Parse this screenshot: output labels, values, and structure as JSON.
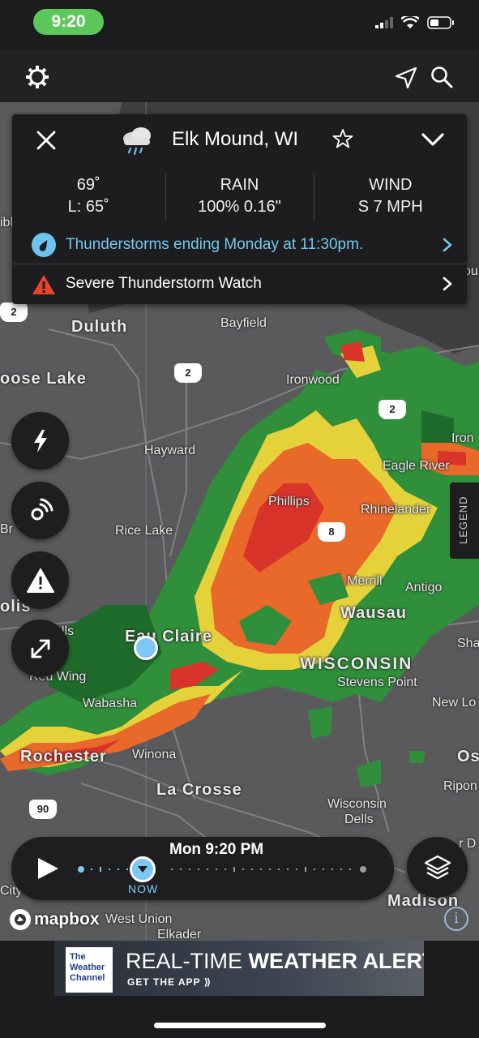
{
  "status_bar": {
    "time": "9:20"
  },
  "location_card": {
    "location": "Elk Mound, WI",
    "temp": {
      "high": "69˚",
      "low": "L: 65˚"
    },
    "rain": {
      "label": "RAIN",
      "value": "100% 0.16\""
    },
    "wind": {
      "label": "WIND",
      "value": "S 7 MPH"
    },
    "forecast_text": "Thunderstorms ending Monday at 11:30pm.",
    "alert_text": "Severe Thunderstorm Watch"
  },
  "map_labels": {
    "duluth": "Duluth",
    "bayfield": "Bayfield",
    "moose_lake": "oose Lake",
    "ironwood": "Ironwood",
    "iron": "Iron",
    "eagle_river": "Eagle River",
    "hayward": "Hayward",
    "phillips": "Phillips",
    "rhinelander": "Rhinelander",
    "rice_lake": "Rice Lake",
    "merrill": "Merrill",
    "antigo": "Antigo",
    "wausau": "Wausau",
    "eau_claire": "Eau Claire",
    "wisconsin": "WISCONSIN",
    "stevens_point": "Stevens Point",
    "sha": "Sha",
    "red_wing": "Red Wing",
    "wabasha": "Wabasha",
    "new_lo": "New Lo",
    "rochester": "Rochester",
    "winona": "Winona",
    "os": "Os",
    "la_crosse": "La Crosse",
    "ripon": "Ripon",
    "wisconsin_dells_1": "Wisconsin",
    "wisconsin_dells_2": "Dells",
    "madison": "Madison",
    "west_union": "West Union",
    "elkader": "Elkader",
    "city": "City",
    "olis": "olis",
    "lls": "lls",
    "br": "Br",
    "ibl": "ibl",
    "ou": "ou",
    "r_d": "r D"
  },
  "route_shields": [
    "2",
    "2",
    "2",
    "8",
    "90"
  ],
  "legend_label": "LEGEND",
  "timeline": {
    "time": "Mon 9:20 PM",
    "now_label": "NOW"
  },
  "attribution": "mapbox",
  "ad": {
    "brand_line1": "The",
    "brand_line2": "Weather",
    "brand_line3": "Channel",
    "headline_light": "REAL-TIME ",
    "headline_bold": "WEATHER ALERTS",
    "sub": "GET THE APP ⟫"
  },
  "colors": {
    "accent_blue": "#74c6f2",
    "status_green": "#5cc85c",
    "alert_red": "#e8432d"
  }
}
